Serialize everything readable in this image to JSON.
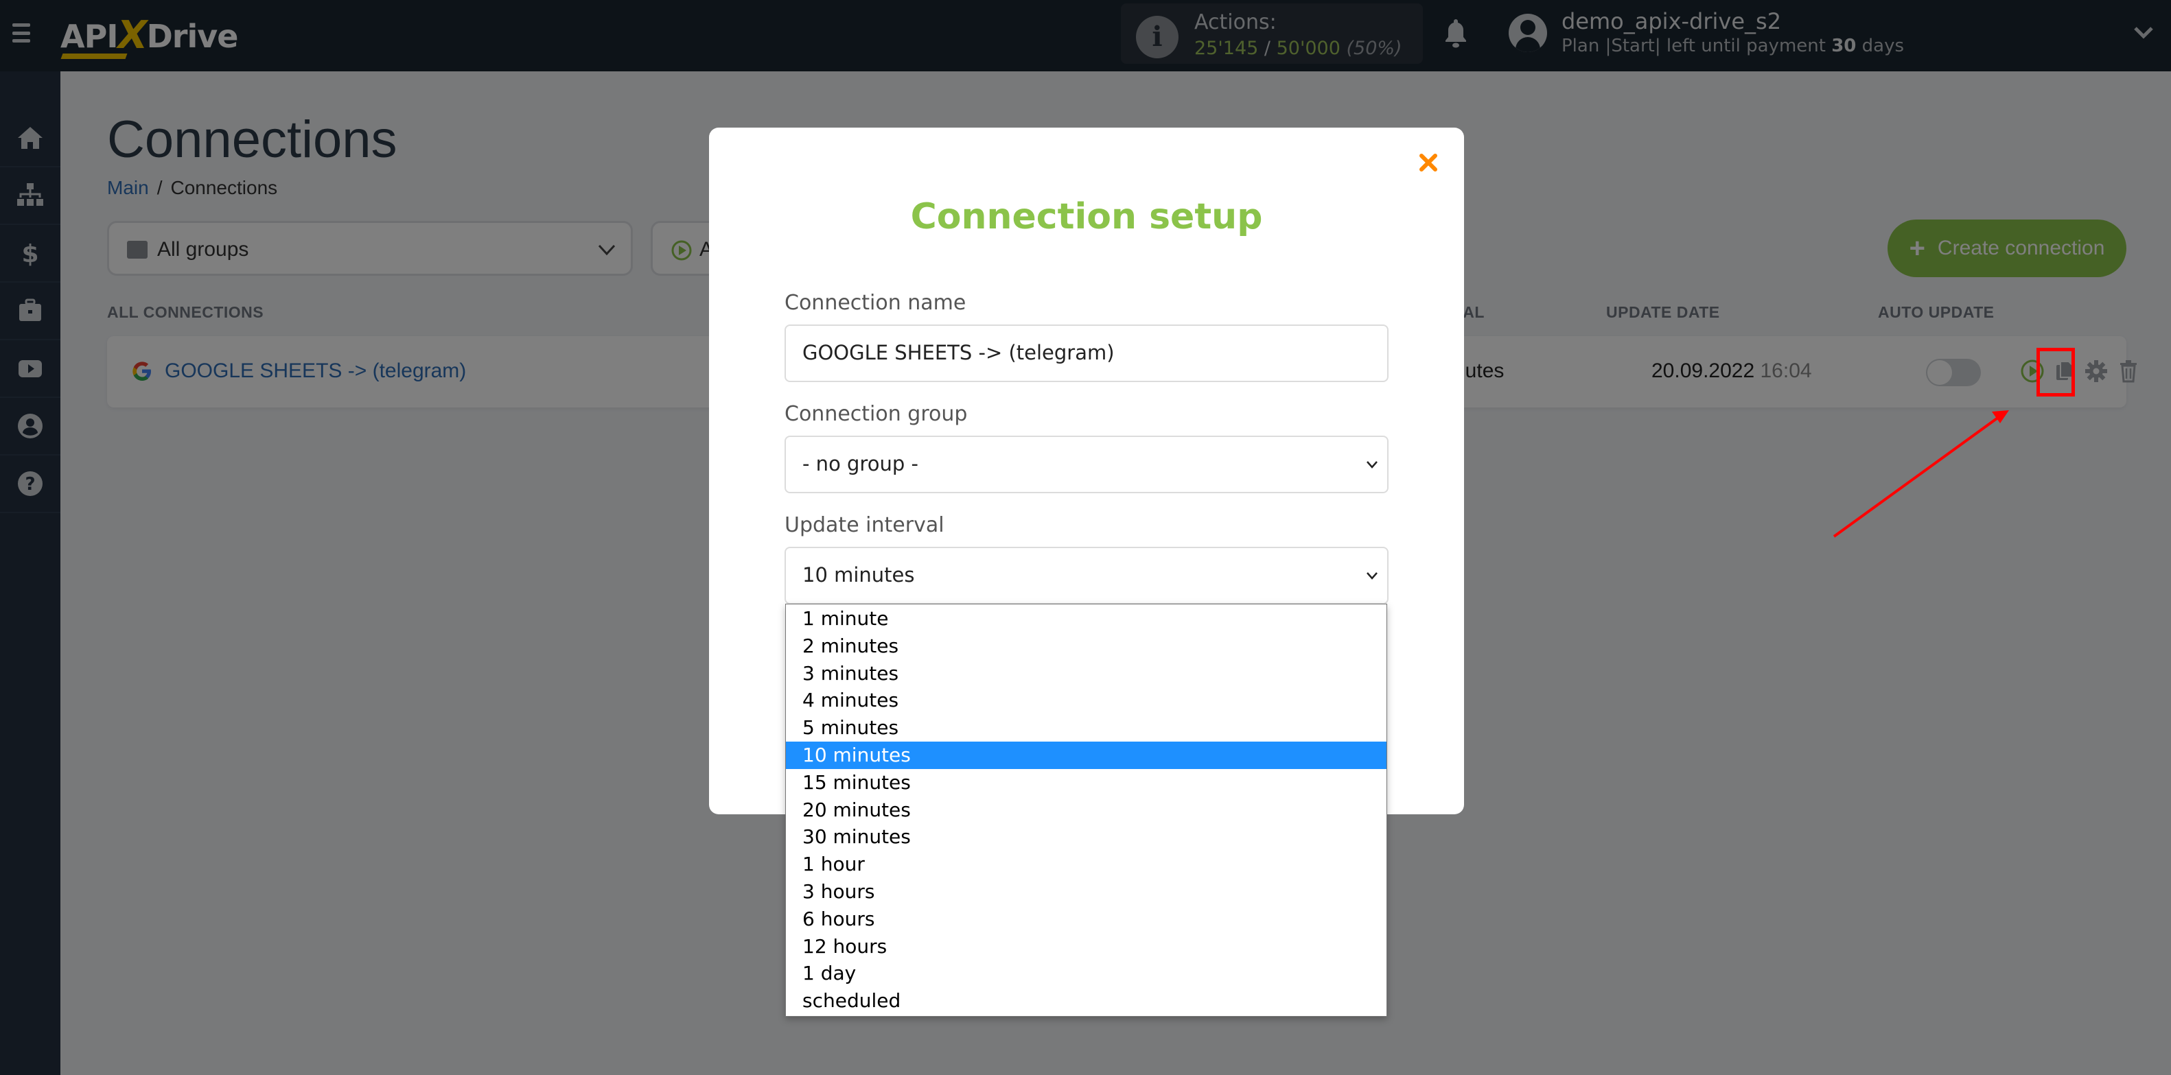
{
  "header": {
    "logo": {
      "left": "API",
      "x": "X",
      "right": "Drive"
    },
    "actions": {
      "label": "Actions:",
      "used": "25'145",
      "separator": " / ",
      "limit": "50'000",
      "percent": "(50%)"
    },
    "user": {
      "name": "demo_apix-drive_s2",
      "plan_prefix": "Plan |Start| left until payment ",
      "days_left": "30",
      "plan_suffix": " days"
    },
    "icons": {
      "menu": "hamburger-icon",
      "info": "info-icon",
      "bell": "bell-icon",
      "avatar": "user-avatar-icon",
      "chevron": "chevron-down-icon"
    }
  },
  "sidebar": {
    "items": [
      {
        "name": "home",
        "icon": "home-icon"
      },
      {
        "name": "connections",
        "icon": "sitemap-icon"
      },
      {
        "name": "billing",
        "icon": "dollar-icon"
      },
      {
        "name": "services",
        "icon": "briefcase-icon"
      },
      {
        "name": "videos",
        "icon": "youtube-icon"
      },
      {
        "name": "profile",
        "icon": "user-circle-icon"
      },
      {
        "name": "help",
        "icon": "question-circle-icon"
      }
    ]
  },
  "page": {
    "title": "Connections",
    "breadcrumb": {
      "main": "Main",
      "separator": "/",
      "current": "Connections"
    },
    "filters": {
      "group": "All groups",
      "status_partial": "A"
    },
    "create_button": {
      "plus": "+",
      "label": "Create connection"
    },
    "table": {
      "headers": {
        "all": "ALL CONNECTIONS",
        "interval": "INTERVAL",
        "update_date": "UPDATE DATE",
        "auto_update": "AUTO UPDATE"
      },
      "rows": [
        {
          "name": "GOOGLE SHEETS -> (telegram)",
          "interval_visible": "nutes",
          "date": "20.09.2022",
          "time": "16:04",
          "auto_update": false
        }
      ]
    }
  },
  "modal": {
    "title": "Connection setup",
    "close": "×",
    "fields": {
      "name": {
        "label": "Connection name",
        "value": "GOOGLE SHEETS -> (telegram)"
      },
      "group": {
        "label": "Connection group",
        "value": "- no group -"
      },
      "interval": {
        "label": "Update interval",
        "value": "10 minutes"
      }
    },
    "interval_options": [
      "1 minute",
      "2 minutes",
      "3 minutes",
      "4 minutes",
      "5 minutes",
      "10 minutes",
      "15 minutes",
      "20 minutes",
      "30 minutes",
      "1 hour",
      "3 hours",
      "6 hours",
      "12 hours",
      "1 day",
      "scheduled"
    ],
    "selected_option": "10 minutes"
  },
  "colors": {
    "brand_green": "#8bc34a",
    "link_blue": "#2f6db5",
    "close_orange": "#ff8800",
    "select_highlight": "#1e90ff",
    "annotation_red": "#ff0000"
  }
}
